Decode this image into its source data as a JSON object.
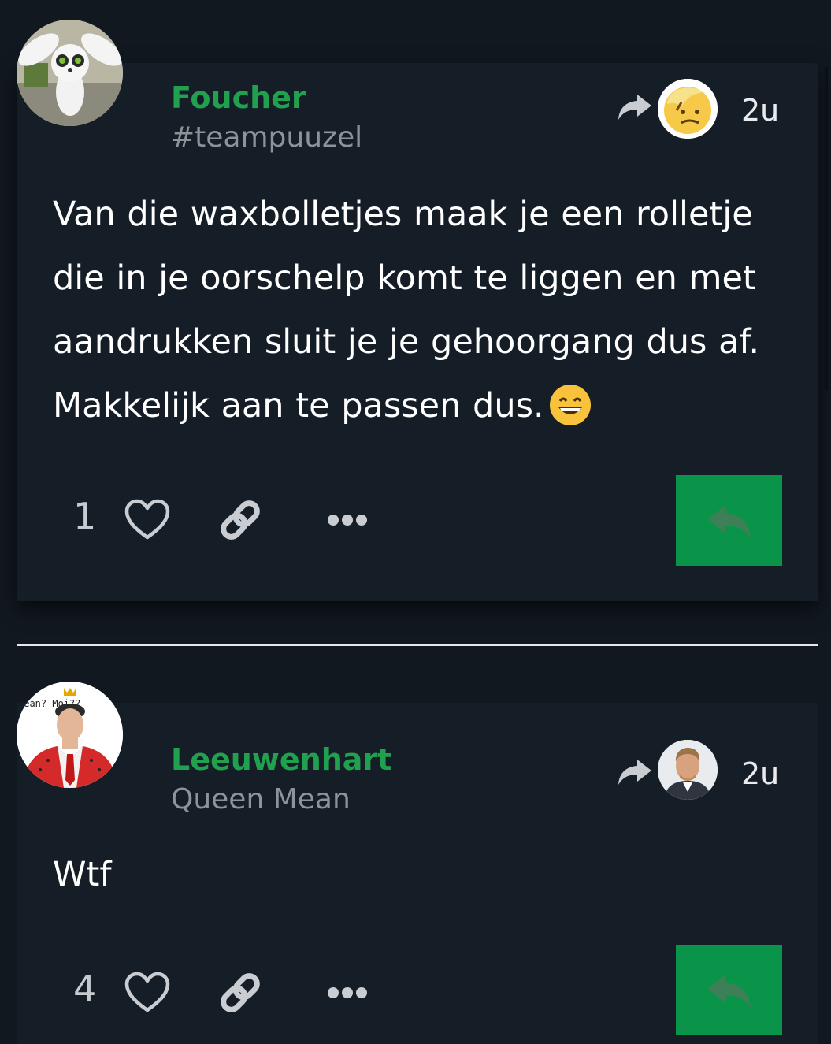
{
  "posts": [
    {
      "username": "Foucher",
      "subtitle": "#teampuuzel",
      "timestamp": "2u",
      "body": "Van die waxbolletjes maak je een rolletje die in je oorschelp komt te liggen en met aandrukken sluit je je gehoorgang dus af. Makkelijk aan te passen dus.",
      "body_emoji": "grinning-face-emoji",
      "like_count": "1",
      "avatar_icon": "lemur-avatar",
      "reposter_icon": "emoji-face-avatar"
    },
    {
      "username": "Leeuwenhart",
      "subtitle": "Queen Mean",
      "timestamp": "2u",
      "body": "Wtf",
      "like_count": "4",
      "avatar_icon": "king-avatar",
      "avatar_caption": "Mean? Moi??",
      "reposter_icon": "man-portrait-avatar"
    }
  ],
  "colors": {
    "background": "#111820",
    "card": "#151d27",
    "username": "#21a14f",
    "accent_button": "#0a9449",
    "subtitle": "#8e9399"
  }
}
